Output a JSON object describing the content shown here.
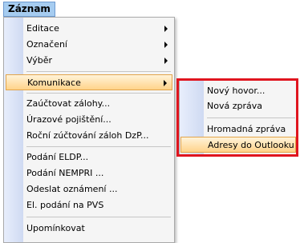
{
  "menubar": {
    "title": "Záznam"
  },
  "menu": {
    "items": [
      {
        "label": "Editace",
        "has_submenu": true
      },
      {
        "label": "Označení",
        "has_submenu": true
      },
      {
        "label": "Výběr",
        "has_submenu": true
      },
      {
        "label": "Komunikace",
        "has_submenu": true,
        "highlighted": true
      },
      {
        "label": "Zaúčtovat zálohy..."
      },
      {
        "label": "Úrazové pojištění..."
      },
      {
        "label": "Roční zúčtování záloh DzP..."
      },
      {
        "label": "Podání ELDP..."
      },
      {
        "label": "Podání NEMPRI ..."
      },
      {
        "label": "Odeslat oznámení ..."
      },
      {
        "label": "El. podání na PVS"
      },
      {
        "label": "Upomínkovat"
      }
    ]
  },
  "submenu": {
    "items": [
      {
        "label": "Nový hovor..."
      },
      {
        "label": "Nová zpráva"
      },
      {
        "label": "Hromadná zpráva"
      },
      {
        "label": "Adresy do Outlooku",
        "highlighted": true
      }
    ]
  },
  "colors": {
    "highlight_border": "#e2a44a",
    "red_frame": "#e0151f",
    "menu_title_bg": "#a6ccf0"
  }
}
